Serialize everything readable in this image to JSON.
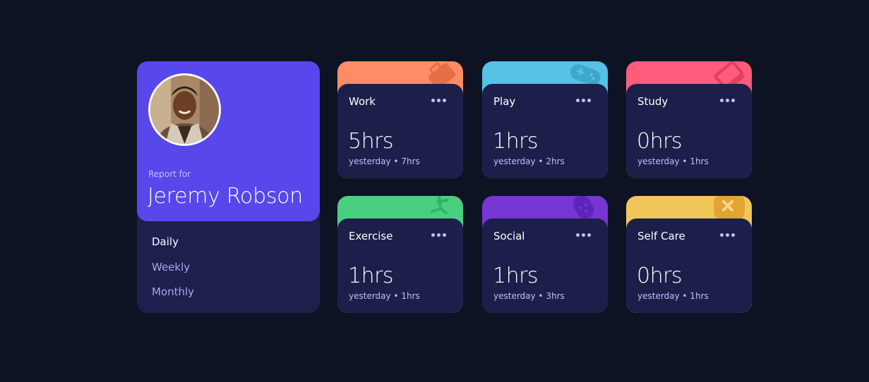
{
  "profile": {
    "report_for": "Report for",
    "name": "Jeremy Robson",
    "periods": [
      {
        "label": "Daily",
        "active": true
      },
      {
        "label": "Weekly",
        "active": false
      },
      {
        "label": "Monthly",
        "active": false
      }
    ]
  },
  "activities": [
    {
      "title": "Work",
      "hours": "5hrs",
      "previous": "yesterday • 7hrs",
      "color": "#ff8c66",
      "icon": "briefcase-icon"
    },
    {
      "title": "Play",
      "hours": "1hrs",
      "previous": "yesterday • 2hrs",
      "color": "#56c2e6",
      "icon": "gamepad-icon"
    },
    {
      "title": "Study",
      "hours": "0hrs",
      "previous": "yesterday • 1hrs",
      "color": "#ff5c7c",
      "icon": "book-icon"
    },
    {
      "title": "Exercise",
      "hours": "1hrs",
      "previous": "yesterday • 1hrs",
      "color": "#4acf81",
      "icon": "running-icon"
    },
    {
      "title": "Social",
      "hours": "1hrs",
      "previous": "yesterday • 3hrs",
      "color": "#7536d3",
      "icon": "chat-icon"
    },
    {
      "title": "Self Care",
      "hours": "0hrs",
      "previous": "yesterday • 1hrs",
      "color": "#f1c65b",
      "icon": "bandage-icon"
    }
  ]
}
